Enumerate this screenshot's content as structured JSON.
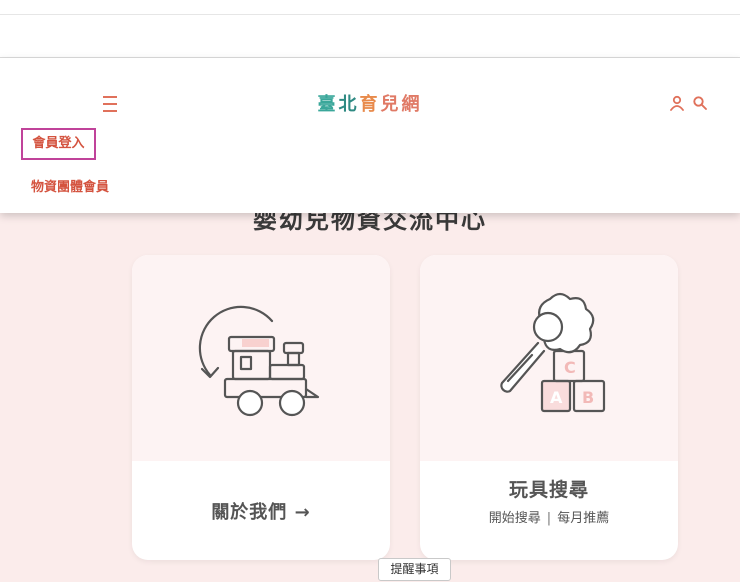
{
  "header": {
    "logo_chars": [
      "臺",
      "北",
      "育",
      "兒",
      "網"
    ],
    "logo_colors": [
      "#3aa79a",
      "#2f8a83",
      "#e88a4b",
      "#e07a66",
      "#e07a66"
    ],
    "menu": {
      "login_label": "會員登入",
      "group_label": "物資團體會員"
    }
  },
  "main": {
    "section_title": "婴幼兒物資交流中心",
    "cards": [
      {
        "link_label": "關於我們 →"
      },
      {
        "title": "玩具搜尋",
        "sub_left": "開始搜尋",
        "sub_sep": "|",
        "sub_right": "每月推薦"
      }
    ]
  },
  "footer": {
    "reminder_label": "提醒事項"
  },
  "colors": {
    "accent": "#e0715b",
    "menu_text": "#d4533f",
    "highlight_border": "#c0439a",
    "content_bg": "#fbeceb"
  },
  "icons": [
    "menu-icon",
    "user-icon",
    "search-icon",
    "toy-train-icon",
    "rattle-blocks-icon"
  ]
}
